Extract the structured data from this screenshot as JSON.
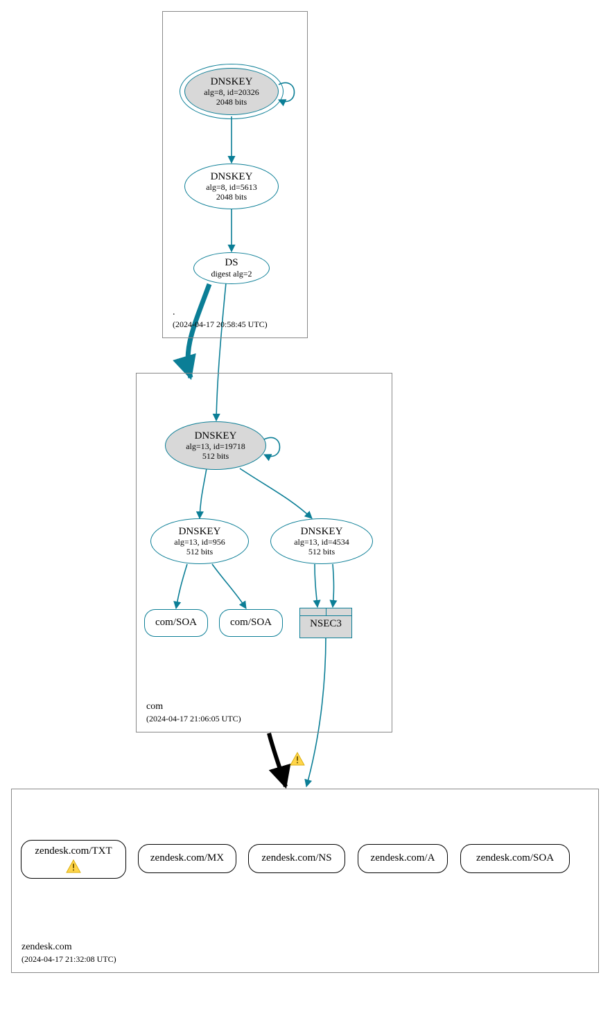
{
  "zones": {
    "root": {
      "name": ".",
      "timestamp": "(2024-04-17 20:58:45 UTC)"
    },
    "com": {
      "name": "com",
      "timestamp": "(2024-04-17 21:06:05 UTC)"
    },
    "leaf": {
      "name": "zendesk.com",
      "timestamp": "(2024-04-17 21:32:08 UTC)"
    }
  },
  "nodes": {
    "root_ksk": {
      "title": "DNSKEY",
      "line2": "alg=8, id=20326",
      "line3": "2048 bits"
    },
    "root_zsk": {
      "title": "DNSKEY",
      "line2": "alg=8, id=5613",
      "line3": "2048 bits"
    },
    "root_ds": {
      "title": "DS",
      "line2": "digest alg=2"
    },
    "com_ksk": {
      "title": "DNSKEY",
      "line2": "alg=13, id=19718",
      "line3": "512 bits"
    },
    "com_zsk1": {
      "title": "DNSKEY",
      "line2": "alg=13, id=956",
      "line3": "512 bits"
    },
    "com_zsk2": {
      "title": "DNSKEY",
      "line2": "alg=13, id=4534",
      "line3": "512 bits"
    },
    "com_soa1": {
      "title": "com/SOA"
    },
    "com_soa2": {
      "title": "com/SOA"
    },
    "nsec3": {
      "title": "NSEC3"
    },
    "leaf_txt": {
      "title": "zendesk.com/TXT"
    },
    "leaf_mx": {
      "title": "zendesk.com/MX"
    },
    "leaf_ns": {
      "title": "zendesk.com/NS"
    },
    "leaf_a": {
      "title": "zendesk.com/A"
    },
    "leaf_soa": {
      "title": "zendesk.com/SOA"
    }
  }
}
